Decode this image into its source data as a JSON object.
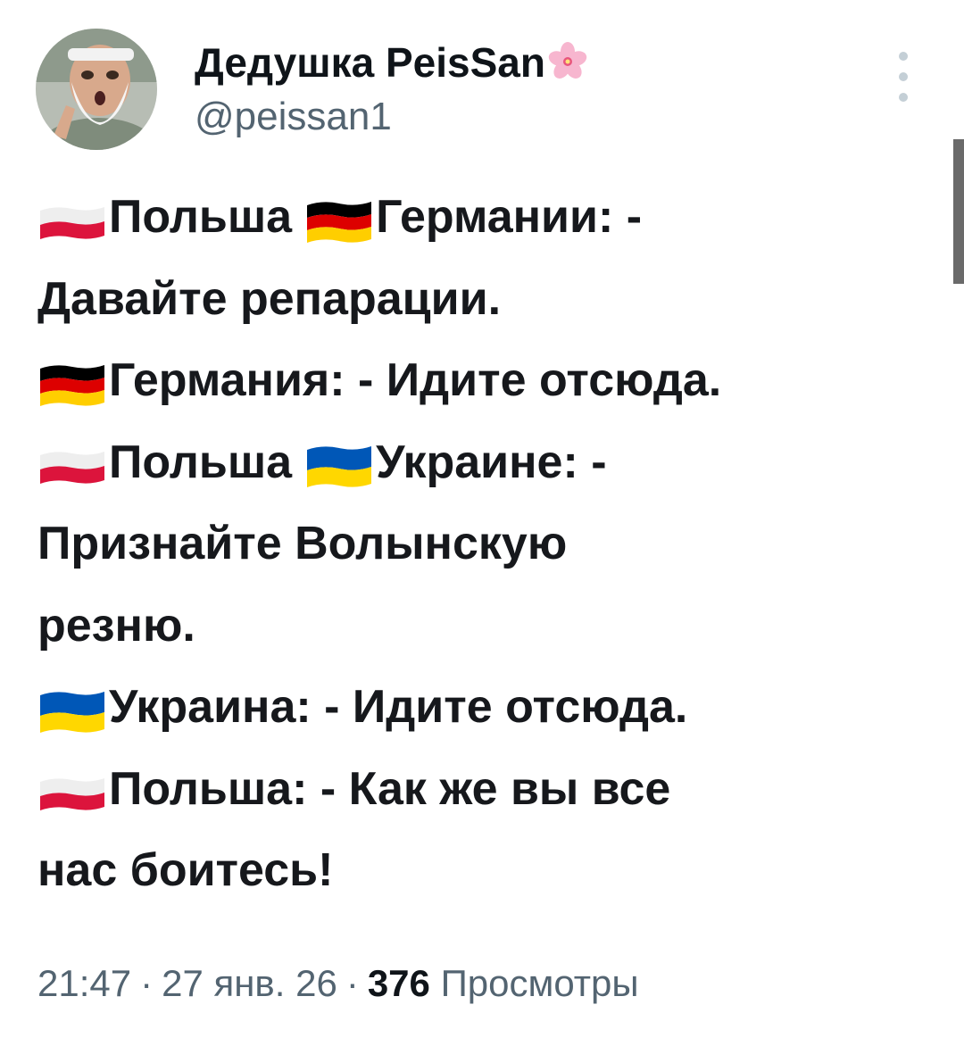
{
  "author": {
    "display_name": "Дедушка PeisSan",
    "handle": "@peissan1",
    "name_emoji": "cherry-blossom-icon"
  },
  "tweet": {
    "lines": [
      {
        "flag": "pl",
        "text": "Польша"
      },
      {
        "flag": "de",
        "text": "Германии: -"
      },
      {
        "flag": null,
        "text": "Давайте репарации."
      },
      {
        "flag": "de",
        "text": "Германия: - Идите отсюда."
      },
      {
        "flag": "pl",
        "text": "Польша"
      },
      {
        "flag": "ua",
        "text": "Украине: -"
      },
      {
        "flag": null,
        "text": "Признайте Волынскую"
      },
      {
        "flag": null,
        "text": "резню."
      },
      {
        "flag": "ua",
        "text": "Украина: - Идите отсюда."
      },
      {
        "flag": "pl",
        "text": "Польша: - Как же вы все"
      },
      {
        "flag": null,
        "text": "нас боитесь!"
      }
    ]
  },
  "meta": {
    "time": "21:47",
    "date": "27 янв. 26",
    "views_count": "376",
    "views_label": "Просмотры",
    "separator": "·"
  },
  "colors": {
    "text": "#0f1419",
    "secondary": "#536471",
    "poland_red": "#dc143c",
    "germany_black": "#000000",
    "germany_red": "#dd0000",
    "germany_gold": "#ffce00",
    "ukraine_blue": "#0057b7",
    "ukraine_yellow": "#ffd700"
  }
}
